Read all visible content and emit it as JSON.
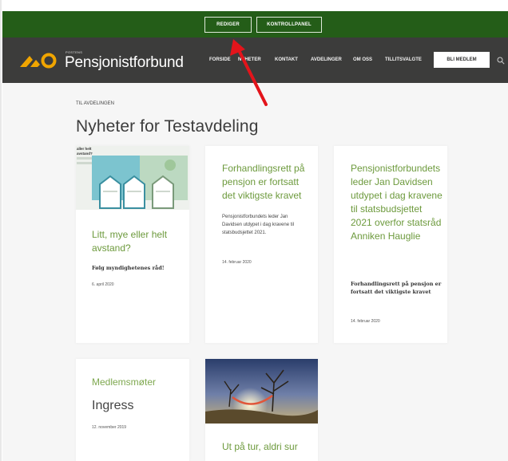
{
  "admin_bar": {
    "edit_label": "REDIGER",
    "control_panel_label": "KONTROLLPANEL",
    "background_color": "#245d18"
  },
  "header": {
    "logo_small_text": "POSTENS",
    "logo_text": "Pensjonistforbund",
    "background_color": "#3c3c3b",
    "menu_items": [
      "FORSIDE",
      "NYHETER",
      "KONTAKT",
      "AVDELINGER",
      "OM OSS",
      "TILLITSVALGTE"
    ],
    "join_label": "BLI MEDLEM",
    "search_icon": "search-icon"
  },
  "breadcrumb": "TIL AVDELINGEN",
  "page_title": "Nyheter for Testavdeling",
  "accent_color": "#6d9a3d",
  "cards": [
    {
      "title": "Litt, mye eller helt avstand?",
      "bold_text": "Følg myndighetenes råd!",
      "date": "6. april 2020",
      "image_label": "aller helt avstand?"
    },
    {
      "title": "Forhandlingsrett på pensjon er fortsatt det viktigste kravet",
      "excerpt": "Pensjonistforbundets leder Jan Davidsen utdypet i dag kravene til statsbudsjettet 2021.",
      "date": "14. februar 2020"
    },
    {
      "title": "Pensjonistforbundets leder Jan Davidsen utdypet i dag kravene til statsbudsjettet 2021 overfor statsråd Anniken Hauglie",
      "bold_text": "Forhandlingsrett på pensjon er fortsatt det viktigste kravet",
      "date": "14. februar 2020"
    },
    {
      "title": "Medlemsmøter",
      "subtitle": "Ingress",
      "date": "12. november 2019"
    },
    {
      "title": "Ut på tur, aldri sur"
    }
  ],
  "annotation_arrow_color": "#e3141b"
}
